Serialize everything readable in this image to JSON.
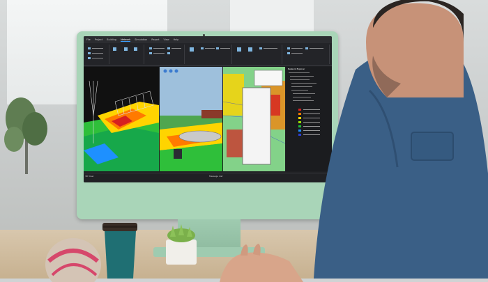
{
  "scene": {
    "description_colors": {
      "monitor_bezel": "#a9d5b8",
      "shirt": "#3a5f86",
      "desk": "#d8c7ad"
    }
  },
  "app": {
    "menu": [
      "File",
      "Project",
      "Building",
      "Network",
      "Simulation",
      "Report",
      "View",
      "Help"
    ],
    "active_menu": "Network",
    "viewport_left_title": "3D View",
    "viewport_right_title": "2D View",
    "panel_title": "Network Explorer",
    "status_message": "Message List",
    "legend_colors": [
      "#d62020",
      "#ff7a00",
      "#ffd400",
      "#9be000",
      "#1fbf3a",
      "#1e90ff",
      "#2a3fd6"
    ]
  }
}
